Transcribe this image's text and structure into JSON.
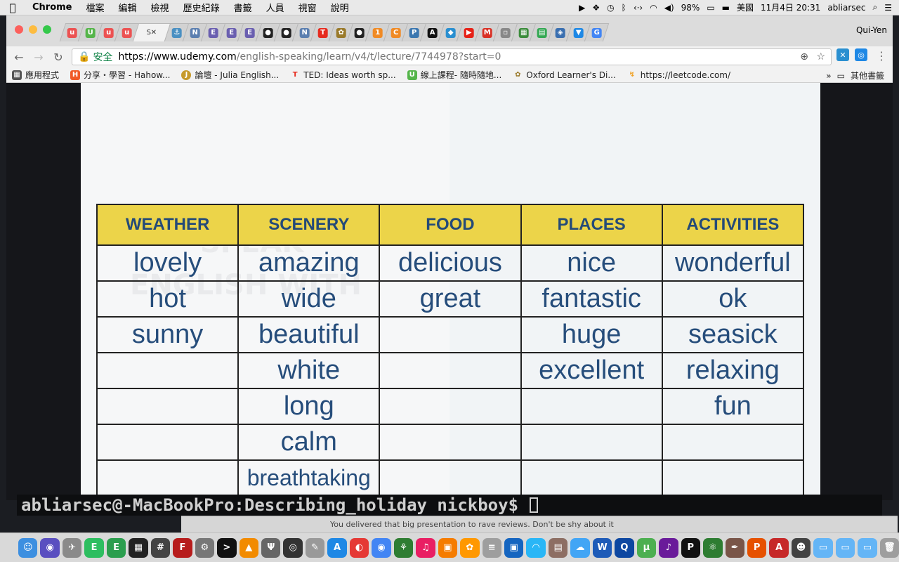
{
  "menubar": {
    "apple": "",
    "app": "Chrome",
    "items": [
      "檔案",
      "編輯",
      "檢視",
      "歷史紀錄",
      "書籤",
      "人員",
      "視窗",
      "說明"
    ],
    "battery": "98%",
    "input_source": "美國",
    "datetime": "11月4日 20:31",
    "user": "abliarsec"
  },
  "browser": {
    "active_tab_label": "S",
    "active_tab_close": "✕",
    "profile": "Qui-Yen",
    "tab_icons": [
      {
        "glyph": "u",
        "color": "#ec5252"
      },
      {
        "glyph": "U",
        "color": "#55b54a"
      },
      {
        "glyph": "u",
        "color": "#ec5252"
      },
      {
        "glyph": "u",
        "color": "#ec5252"
      },
      {
        "glyph": "⚓",
        "color": "#4a90c2"
      },
      {
        "glyph": "N",
        "color": "#5b7fb0"
      },
      {
        "glyph": "E",
        "color": "#6a5fb0"
      },
      {
        "glyph": "E",
        "color": "#6a5fb0"
      },
      {
        "glyph": "E",
        "color": "#6a5fb0"
      },
      {
        "glyph": "●",
        "color": "#222222"
      },
      {
        "glyph": "●",
        "color": "#222222"
      },
      {
        "glyph": "N",
        "color": "#5b7fb0"
      },
      {
        "glyph": "T",
        "color": "#e62b1e"
      },
      {
        "glyph": "✿",
        "color": "#9a7a2a"
      },
      {
        "glyph": "●",
        "color": "#222222"
      },
      {
        "glyph": "1",
        "color": "#f08a24"
      },
      {
        "glyph": "C",
        "color": "#f08a24"
      },
      {
        "glyph": "P",
        "color": "#3b77b0"
      },
      {
        "glyph": "A",
        "color": "#111111"
      },
      {
        "glyph": "◆",
        "color": "#2a8fd0"
      },
      {
        "glyph": "▶",
        "color": "#e62117"
      },
      {
        "glyph": "M",
        "color": "#d93025"
      },
      {
        "glyph": "▫",
        "color": "#888888"
      },
      {
        "glyph": "▦",
        "color": "#3c8c3c"
      },
      {
        "glyph": "▤",
        "color": "#34a853"
      },
      {
        "glyph": "◈",
        "color": "#3a6fb0"
      },
      {
        "glyph": "▼",
        "color": "#1e88e5"
      },
      {
        "glyph": "G",
        "color": "#4285f4"
      }
    ],
    "url_secure_label": "安全",
    "url_host": "https://www.udemy.com",
    "url_path": "/english-speaking/learn/v4/t/lecture/7744978?start=0",
    "bookmarks": [
      {
        "label": "應用程式",
        "color": "#555555",
        "glyph": "▦"
      },
      {
        "label": "分享・學習 - Hahow...",
        "color": "#f05a28",
        "glyph": "H"
      },
      {
        "label": "論壇 - Julia English...",
        "color": "#c69a2b",
        "glyph": "J"
      },
      {
        "label": "TED: Ideas worth sp...",
        "color": "#e62b1e",
        "glyph": "T"
      },
      {
        "label": "線上課程- 隨時隨地...",
        "color": "#55b54a",
        "glyph": "U"
      },
      {
        "label": "Oxford Learner's Di...",
        "color": "#9a7a2a",
        "glyph": "✿"
      },
      {
        "label": "https://leetcode.com/",
        "color": "#f0a020",
        "glyph": "L"
      }
    ],
    "bookmarks_more": "»",
    "other_bookmarks": "其他書籤"
  },
  "slide": {
    "columns": [
      "WEATHER",
      "SCENERY",
      "FOOD",
      "PLACES",
      "ACTIVITIES"
    ],
    "rows": [
      [
        "lovely",
        "amazing",
        "delicious",
        "nice",
        "wonderful"
      ],
      [
        "hot",
        "wide",
        "great",
        "fantastic",
        "ok"
      ],
      [
        "sunny",
        "beautiful",
        "",
        "huge",
        "seasick"
      ],
      [
        "",
        "white",
        "",
        "excellent",
        "relaxing"
      ],
      [
        "",
        "long",
        "",
        "",
        "fun"
      ],
      [
        "",
        "calm",
        "",
        "",
        ""
      ],
      [
        "",
        "breathtaking",
        "",
        "",
        ""
      ]
    ],
    "header_color": "#ecd449",
    "text_color": "#264d7b"
  },
  "terminal": {
    "prompt": "abliarsec@-MacBookPro:Describing_holiday nickboy$"
  },
  "background_window": {
    "notice": "You delivered that big presentation to rave reviews. Don't be shy about it"
  },
  "dock": {
    "icons": [
      {
        "name": "finder-icon",
        "color": "#3d8fe0",
        "glyph": "☺"
      },
      {
        "name": "siri-icon",
        "color": "#5a4fc0",
        "glyph": "◉"
      },
      {
        "name": "launchpad-icon",
        "color": "#8a8a8a",
        "glyph": "✈"
      },
      {
        "name": "evernote-icon",
        "color": "#2dbe60",
        "glyph": "E"
      },
      {
        "name": "evernote-alt-icon",
        "color": "#2b9e4e",
        "glyph": "E"
      },
      {
        "name": "window-manager-icon",
        "color": "#222222",
        "glyph": "▦"
      },
      {
        "name": "notes-icon",
        "color": "#444444",
        "glyph": "#"
      },
      {
        "name": "filezilla-icon",
        "color": "#b71c1c",
        "glyph": "F"
      },
      {
        "name": "system-preferences-icon",
        "color": "#777777",
        "glyph": "⚙"
      },
      {
        "name": "terminal-icon",
        "color": "#111111",
        "glyph": ">"
      },
      {
        "name": "vlc-icon",
        "color": "#f28b00",
        "glyph": "▲"
      },
      {
        "name": "pgp-icon",
        "color": "#666666",
        "glyph": "Ψ"
      },
      {
        "name": "media-icon",
        "color": "#333333",
        "glyph": "◎"
      },
      {
        "name": "editor-icon",
        "color": "#999999",
        "glyph": "✎"
      },
      {
        "name": "app-store-icon",
        "color": "#1e88e5",
        "glyph": "A"
      },
      {
        "name": "app-badge-icon",
        "color": "#e53935",
        "glyph": "◐"
      },
      {
        "name": "chrome-icon",
        "color": "#4285f4",
        "glyph": "◉"
      },
      {
        "name": "sourcetree-icon",
        "color": "#2e7d32",
        "glyph": "⚘"
      },
      {
        "name": "itunes-icon",
        "color": "#e91e63",
        "glyph": "♫"
      },
      {
        "name": "ibooks-icon",
        "color": "#f57c00",
        "glyph": "▣"
      },
      {
        "name": "photos-icon",
        "color": "#ff9800",
        "glyph": "✿"
      },
      {
        "name": "database-icon",
        "color": "#9e9e9e",
        "glyph": "≡"
      },
      {
        "name": "virtualbox-icon",
        "color": "#1565c0",
        "glyph": "▣"
      },
      {
        "name": "wifi-app-icon",
        "color": "#29b6f6",
        "glyph": "◠"
      },
      {
        "name": "preview-icon",
        "color": "#8d6e63",
        "glyph": "▤"
      },
      {
        "name": "cloud-icon",
        "color": "#42a5f5",
        "glyph": "☁"
      },
      {
        "name": "word-icon",
        "color": "#1e5bb8",
        "glyph": "W"
      },
      {
        "name": "quicktime-icon",
        "color": "#0d47a1",
        "glyph": "Q"
      },
      {
        "name": "utorrent-icon",
        "color": "#4caf50",
        "glyph": "μ"
      },
      {
        "name": "headphones-icon",
        "color": "#6a1b9a",
        "glyph": "♪"
      },
      {
        "name": "pycharm-icon",
        "color": "#111111",
        "glyph": "P"
      },
      {
        "name": "atom-icon",
        "color": "#2e7d32",
        "glyph": "⚛"
      },
      {
        "name": "pen-icon",
        "color": "#795548",
        "glyph": "✒"
      },
      {
        "name": "powerpoint-icon",
        "color": "#e65100",
        "glyph": "P"
      },
      {
        "name": "acrobat-icon",
        "color": "#c62828",
        "glyph": "A"
      },
      {
        "name": "panda-icon",
        "color": "#424242",
        "glyph": "☻"
      },
      {
        "name": "applications-folder-icon",
        "color": "#64b5f6",
        "glyph": "▭"
      },
      {
        "name": "documents-folder-icon",
        "color": "#64b5f6",
        "glyph": "▭"
      },
      {
        "name": "downloads-folder-icon",
        "color": "#64b5f6",
        "glyph": "▭"
      },
      {
        "name": "trash-icon",
        "color": "#9e9e9e",
        "glyph": "🗑"
      }
    ]
  }
}
